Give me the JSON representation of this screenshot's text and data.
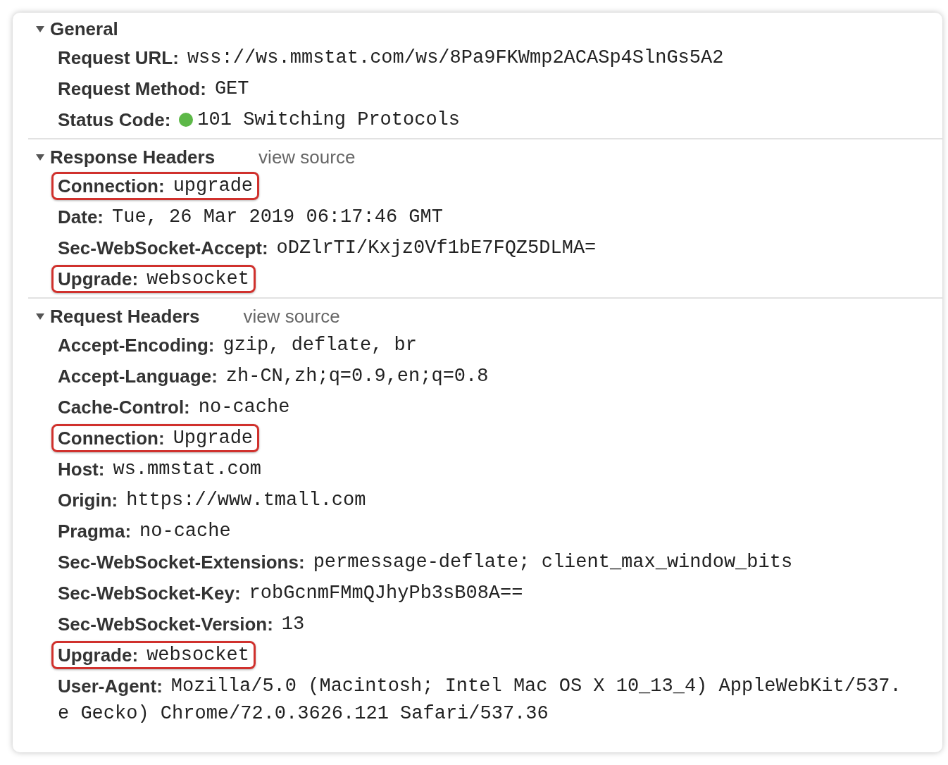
{
  "sections": [
    {
      "title": "General",
      "expanded": true,
      "rows": [
        {
          "name": "Request URL:",
          "value": "wss://ws.mmstat.com/ws/8Pa9FKWmp2ACASp4SlnGs5A2",
          "highlighted": false
        },
        {
          "name": "Request Method:",
          "value": "GET",
          "highlighted": false
        },
        {
          "name": "Status Code:",
          "value": "101 Switching Protocols",
          "color": "#5db848",
          "highlighted": false
        }
      ]
    },
    {
      "title": "Response Headers",
      "link": "view source",
      "expanded": true,
      "rows": [
        {
          "name": "Connection:",
          "value": "upgrade",
          "highlighted": true
        },
        {
          "name": "Date:",
          "value": "Tue, 26 Mar 2019 06:17:46 GMT",
          "highlighted": false
        },
        {
          "name": "Sec-WebSocket-Accept:",
          "value": "oDZlrTI/Kxjz0Vf1bE7FQZ5DLMA=",
          "highlighted": false
        },
        {
          "name": "Upgrade:",
          "value": "websocket",
          "highlighted": true
        }
      ]
    },
    {
      "title": "Request Headers",
      "link": "view source",
      "expanded": true,
      "rows": [
        {
          "name": "Accept-Encoding:",
          "value": "gzip, deflate, br",
          "highlighted": false
        },
        {
          "name": "Accept-Language:",
          "value": "zh-CN,zh;q=0.9,en;q=0.8",
          "highlighted": false
        },
        {
          "name": "Cache-Control:",
          "value": "no-cache",
          "highlighted": false
        },
        {
          "name": "Connection:",
          "value": "Upgrade",
          "highlighted": true
        },
        {
          "name": "Host:",
          "value": "ws.mmstat.com",
          "highlighted": false
        },
        {
          "name": "Origin:",
          "value": "https://www.tmall.com",
          "highlighted": false
        },
        {
          "name": "Pragma:",
          "value": "no-cache",
          "highlighted": false
        },
        {
          "name": "Sec-WebSocket-Extensions:",
          "value": "permessage-deflate; client_max_window_bits",
          "highlighted": false
        },
        {
          "name": "Sec-WebSocket-Key:",
          "value": "robGcnmFMmQJhyPb3sB08A==",
          "highlighted": false
        },
        {
          "name": "Sec-WebSocket-Version:",
          "value": "13",
          "highlighted": false
        },
        {
          "name": "Upgrade:",
          "value": "websocket",
          "highlighted": true
        },
        {
          "name": "User-Agent:",
          "value": "Mozilla/5.0 (Macintosh; Intel Mac OS X 10_13_4) AppleWebKit/537.",
          "continuation": "e Gecko) Chrome/72.0.3626.121 Safari/537.36",
          "highlighted": false
        }
      ]
    }
  ]
}
